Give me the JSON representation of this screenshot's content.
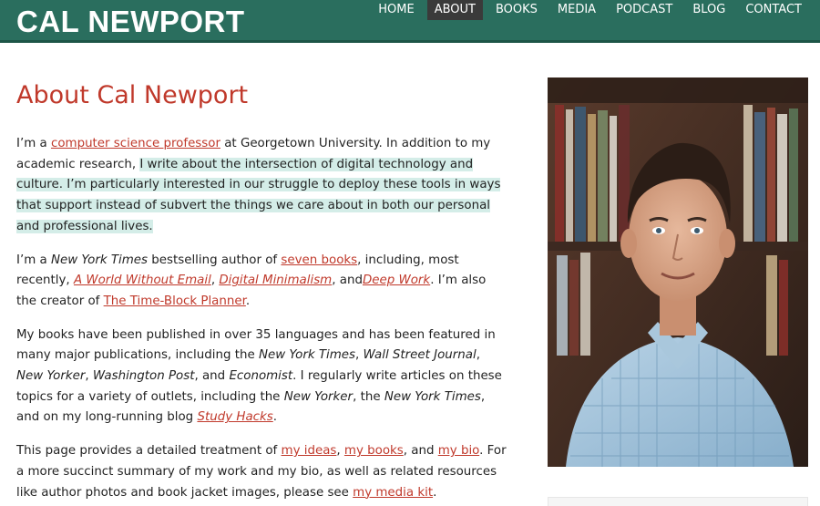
{
  "site": {
    "logo": "CAL NEWPORT"
  },
  "nav": {
    "items": [
      "HOME",
      "ABOUT",
      "BOOKS",
      "MEDIA",
      "PODCAST",
      "BLOG",
      "CONTACT"
    ],
    "active": "ABOUT"
  },
  "page": {
    "title": "About Cal Newport"
  },
  "p1": {
    "t1": "I’m a ",
    "link1": "computer science professor",
    "t2": " at Georgetown University. In addition to my academic research, ",
    "highlight": "I write about the intersection of digital technology and culture. I’m particularly interested in our struggle to deploy these tools in ways that support instead of subvert the things we care about in both our personal and professional lives."
  },
  "p2": {
    "t1": "I’m a ",
    "i1": "New York Times",
    "t2": " bestselling author of ",
    "link1": "seven books",
    "t3": ", including, most recently, ",
    "link2": "A World Without Email",
    "t4": ", ",
    "link3": "Digital Minimalism",
    "t5": ", and",
    "link4": "Deep Work",
    "t6": ". I’m also the creator of ",
    "link5": "The Time-Block Planner",
    "t7": "."
  },
  "p3": {
    "t1": "My books have been published in over 35 languages and has been featured in many major publications, including the ",
    "i1": "New York Times",
    "t2": ", ",
    "i2": "Wall Street Journal",
    "t3": ", ",
    "i3": "New Yorker",
    "t4": ", ",
    "i4": "Washington Post",
    "t5": ", and ",
    "i5": "Economist",
    "t6": ". I regularly write articles on these topics for a variety of outlets, including the ",
    "i6": "New Yorker",
    "t7": ", the ",
    "i7": "New York Times",
    "t8": ", and on my long-running blog ",
    "link1": "Study Hacks",
    "t9": "."
  },
  "p4": {
    "t1": "This page provides a detailed treatment of ",
    "link1": "my ideas",
    "t2": ", ",
    "link2": "my books",
    "t3": ", and ",
    "link3": "my bio",
    "t4": ". For a more succinct summary of my work and my bio, as well as related resources like author photos and book jacket images, please see ",
    "link4": "my media kit",
    "t5": "."
  },
  "colors": {
    "header": "#2a6e5e",
    "accent": "#c0392b",
    "highlight": "#d4ede8",
    "nav_active": "#3a3a3a"
  }
}
